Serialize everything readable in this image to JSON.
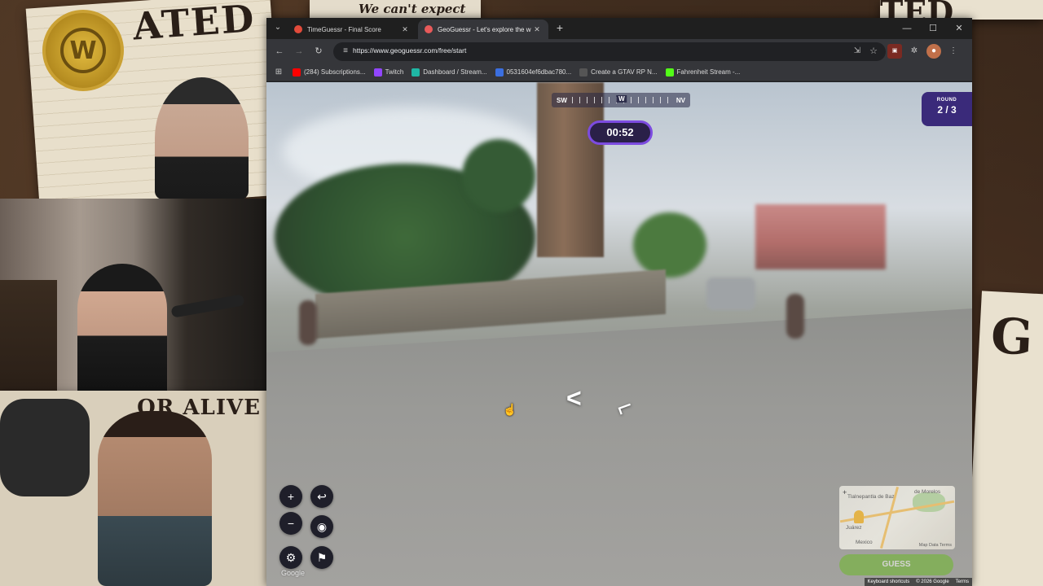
{
  "overlay": {
    "poster_left_text": "ATED",
    "poster_top_text": "We can't expect",
    "poster_right_top_text": "TED",
    "poster_right_text": "G",
    "poster_alive_text": "OR ALIVE",
    "logo_letter": "W"
  },
  "browser": {
    "tabs": [
      {
        "title": "TimeGuessr - Final Score",
        "favicon_color": "#e24b3b",
        "active": false
      },
      {
        "title": "GeoGuessr - Let's explore the w",
        "favicon_color": "#e85a5a",
        "active": true
      }
    ],
    "address": {
      "url": "https://www.geoguessr.com/free/start"
    },
    "bookmarks": [
      {
        "label": "(284) Subscriptions...",
        "color": "#ff0000"
      },
      {
        "label": "Twitch",
        "color": "#9146ff"
      },
      {
        "label": "Dashboard / Stream...",
        "color": "#1fb7a5"
      },
      {
        "label": "0531604ef6dbac780...",
        "color": "#3b6fe0"
      },
      {
        "label": "Create a GTAV RP N...",
        "color": "#555555"
      },
      {
        "label": "Fahrenheit Stream -...",
        "color": "#53fc18"
      }
    ],
    "icons": {
      "tab_list": "chevron-down-icon",
      "new_tab": "plus-icon",
      "back": "back-arrow-icon",
      "forward": "forward-arrow-icon",
      "reload": "reload-icon",
      "site_info": "tune-icon",
      "install": "install-icon",
      "bookmark": "star-icon",
      "extensions": "puzzle-icon",
      "menu": "kebab-icon"
    }
  },
  "game": {
    "compass": {
      "left": "SW",
      "center": "W",
      "right": "NV"
    },
    "timer": "00:52",
    "round_label": "ROUND",
    "round_value": "2 / 3",
    "controls": {
      "zoom_in": "+",
      "zoom_out": "−",
      "undo": "↩",
      "return_to_start": "◉",
      "settings": "⚙",
      "flag": "⚑"
    },
    "google_label": "Google",
    "minimap": {
      "place1": "Tlalnepantla de Baz",
      "place2": "de Morelos",
      "place3": "Mexico",
      "place4": "Juárez",
      "attribution": "Map Data   Terms"
    },
    "guess_label": "GUESS",
    "footer": {
      "shortcuts": "Keyboard shortcuts",
      "copyright": "© 2026 Google",
      "terms": "Terms"
    }
  }
}
